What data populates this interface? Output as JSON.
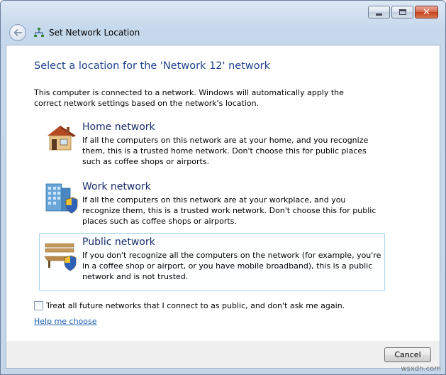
{
  "window": {
    "title": "Set Network Location",
    "caption_buttons": [
      "minimize-icon",
      "maximize-icon",
      "close-icon"
    ]
  },
  "heading": "Select a location for the 'Network  12' network",
  "intro": "This computer is connected to a network. Windows will automatically apply the correct network settings based on the network's location.",
  "options": [
    {
      "title": "Home network",
      "description": "If all the computers on this network are at your home, and you recognize them, this is a trusted home network.  Don't choose this for public places such as coffee shops or airports.",
      "icon": "house-icon",
      "selected": false
    },
    {
      "title": "Work network",
      "description": "If all the computers on this network are at your workplace, and you recognize them, this is a trusted work network.  Don't choose this for public places such as coffee shops or airports.",
      "icon": "office-building-shield-icon",
      "selected": false
    },
    {
      "title": "Public network",
      "description": "If you don't recognize all the computers on the network (for example, you're in a coffee shop or airport, or you have mobile broadband), this is a public network and is not trusted.",
      "icon": "park-bench-shield-icon",
      "selected": true
    }
  ],
  "checkbox": {
    "label": "Treat all future networks that I connect to as public, and don't ask me again.",
    "checked": false
  },
  "help_link": "Help me choose",
  "cancel_label": "Cancel",
  "watermark": "wsxdn.com",
  "colors": {
    "heading": "#1e3f8c",
    "link": "#1b5fb3",
    "selection_border": "#a8d8ec"
  }
}
